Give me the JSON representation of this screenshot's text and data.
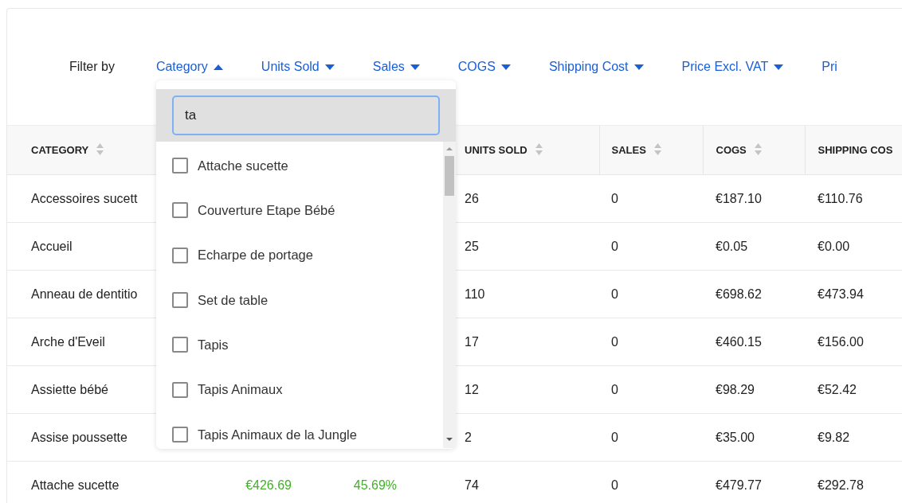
{
  "filter_bar": {
    "label": "Filter by",
    "filters": [
      {
        "label": "Category",
        "expanded": true
      },
      {
        "label": "Units Sold",
        "expanded": false
      },
      {
        "label": "Sales",
        "expanded": false
      },
      {
        "label": "COGS",
        "expanded": false
      },
      {
        "label": "Shipping Cost",
        "expanded": false
      },
      {
        "label": "Price Excl. VAT",
        "expanded": false
      },
      {
        "label": "Pri"
      }
    ]
  },
  "dropdown": {
    "search": {
      "value": "ta"
    },
    "options": [
      {
        "label": "Attache sucette",
        "checked": false
      },
      {
        "label": "Couverture Etape Bébé",
        "checked": false
      },
      {
        "label": "Echarpe de portage",
        "checked": false
      },
      {
        "label": "Set de table",
        "checked": false
      },
      {
        "label": "Tapis",
        "checked": false
      },
      {
        "label": "Tapis Animaux",
        "checked": false
      },
      {
        "label": "Tapis Animaux de la Jungle",
        "checked": false
      }
    ]
  },
  "table": {
    "columns": [
      "CATEGORY",
      null,
      null,
      "UNITS SOLD",
      "SALES",
      "COGS",
      "SHIPPING COS"
    ],
    "rows": [
      {
        "cells": [
          {
            "text": "Accessoires sucett"
          },
          null,
          null,
          {
            "text": "26"
          },
          {
            "text": "0"
          },
          {
            "text": "€187.10"
          },
          {
            "text": "€110.76"
          }
        ]
      },
      {
        "cells": [
          {
            "text": "Accueil"
          },
          null,
          null,
          {
            "text": "25"
          },
          {
            "text": "0"
          },
          {
            "text": "€0.05"
          },
          {
            "text": "€0.00"
          }
        ]
      },
      {
        "cells": [
          {
            "text": "Anneau de dentitio"
          },
          null,
          null,
          {
            "text": "110"
          },
          {
            "text": "0"
          },
          {
            "text": "€698.62"
          },
          {
            "text": "€473.94"
          }
        ]
      },
      {
        "cells": [
          {
            "text": "Arche d'Eveil"
          },
          null,
          null,
          {
            "text": "17"
          },
          {
            "text": "0"
          },
          {
            "text": "€460.15"
          },
          {
            "text": "€156.00"
          }
        ]
      },
      {
        "cells": [
          {
            "text": "Assiette bébé"
          },
          null,
          null,
          {
            "text": "12"
          },
          {
            "text": "0"
          },
          {
            "text": "€98.29"
          },
          {
            "text": "€52.42"
          }
        ]
      },
      {
        "cells": [
          {
            "text": "Assise poussette"
          },
          null,
          null,
          {
            "text": "2"
          },
          {
            "text": "0"
          },
          {
            "text": "€35.00"
          },
          {
            "text": "€9.82"
          }
        ]
      },
      {
        "cells": [
          {
            "text": "Attache sucette"
          },
          {
            "text": "€426.69",
            "positive": true
          },
          {
            "text": "45.69%",
            "positive": true
          },
          {
            "text": "74"
          },
          {
            "text": "0"
          },
          {
            "text": "€479.77"
          },
          {
            "text": "€292.78"
          }
        ]
      }
    ]
  }
}
